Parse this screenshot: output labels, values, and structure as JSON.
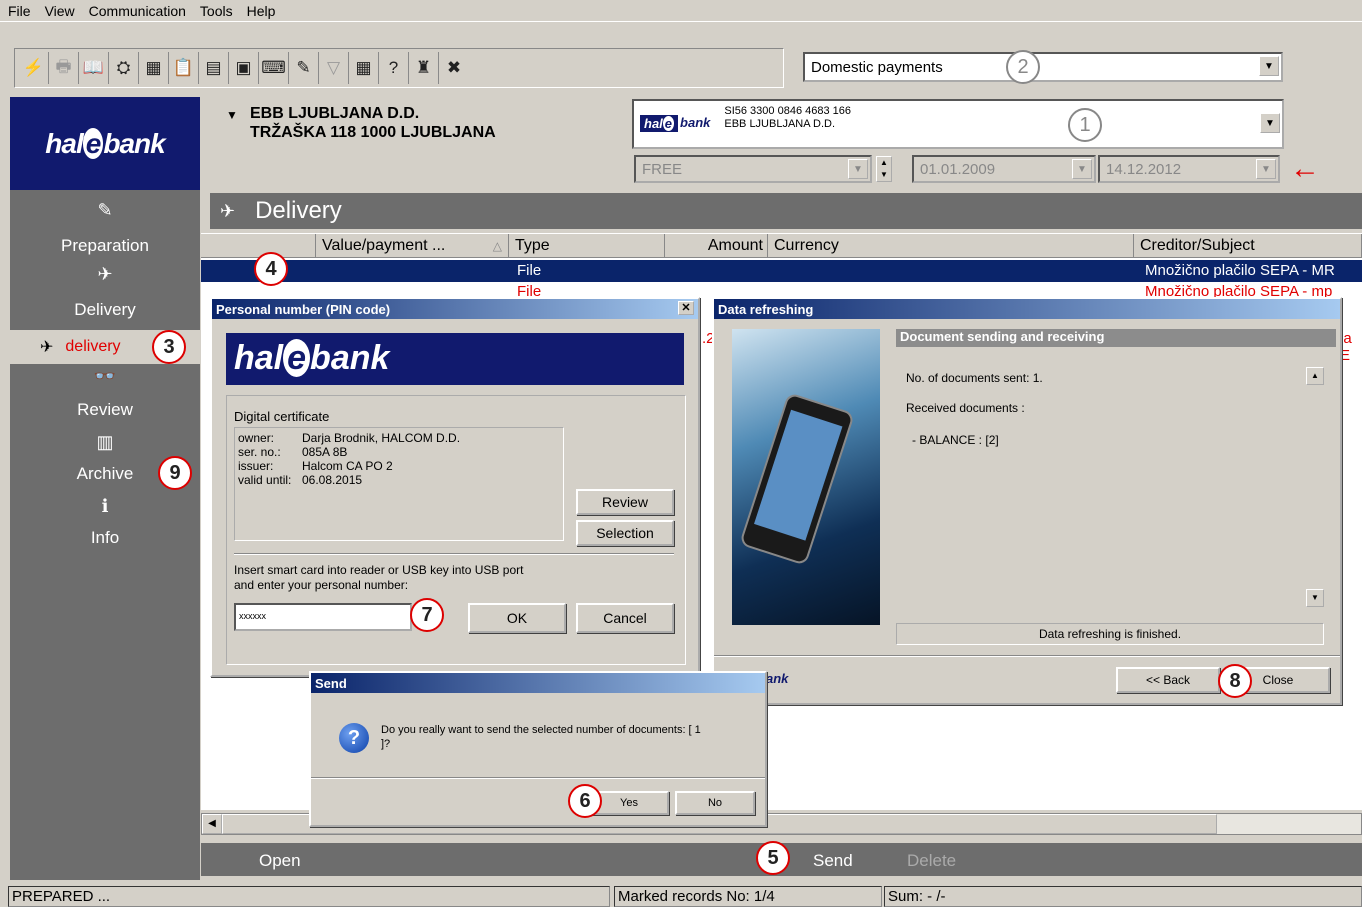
{
  "menu": [
    "File",
    "View",
    "Communication",
    "Tools",
    "Help"
  ],
  "toolbar": {
    "icons": [
      "lightning-icon",
      "printer-icon",
      "book-icon",
      "sync-icon",
      "code-icon",
      "clipboard-icon",
      "form-icon",
      "card-icon",
      "keyboard-icon",
      "edit-icon",
      "filter-icon",
      "calculator-icon",
      "help-icon",
      "lock-icon",
      "close-x-icon"
    ],
    "glyphs": [
      "⚡",
      "🖶",
      "📖",
      "⛭",
      "▦",
      "📋",
      "▤",
      "▣",
      "⌨",
      "✎",
      "▽",
      "▦",
      "?",
      "♜",
      "✖"
    ],
    "payment_type": "Domestic payments"
  },
  "callouts": {
    "c1": "1",
    "c2": "2",
    "c3": "3",
    "c4": "4",
    "c5": "5",
    "c6": "6",
    "c7": "7",
    "c8": "8",
    "c9": "9"
  },
  "logo": {
    "pre": "hal",
    "e": "e",
    "post": "bank"
  },
  "bank": {
    "name": "EBB LJUBLJANA D.D.",
    "address": "TRŽAŠKA 118 1000 LJUBLJANA",
    "account_number": "SI56 3300 0846 4683 166",
    "account_name": "EBB LJUBLJANA D.D.",
    "filter": "FREE",
    "date_from": "01.01.2009",
    "date_to": "14.12.2012"
  },
  "sidebar": {
    "preparation": "Preparation",
    "delivery": "Delivery",
    "delivery_sub": "delivery",
    "review": "Review",
    "archive": "Archive",
    "info": "Info"
  },
  "main": {
    "title": "Delivery",
    "columns": [
      "Value/payment ...",
      "Type",
      "Amount",
      "Currency",
      "Creditor/Subject"
    ],
    "rows": [
      {
        "type": "File",
        "subject": "Množično plačilo SEPA - MR"
      },
      {
        "type": "File",
        "subject": "Množično plačilo SEPA - mp"
      }
    ],
    "row3_frag": ".2",
    "row3_subject": "ja E"
  },
  "pin_dialog": {
    "title": "Personal number (PIN code)",
    "cert_label": "Digital certificate",
    "owner_k": "owner:",
    "owner_v": "Darja Brodnik, HALCOM D.D.",
    "ser_k": "ser. no.:",
    "ser_v": "085A 8B",
    "issuer_k": "issuer:",
    "issuer_v": "Halcom CA PO 2",
    "valid_k": "valid until:",
    "valid_v": "06.08.2015",
    "review": "Review",
    "selection": "Selection",
    "instruction1": "Insert smart card into reader or USB key into USB port",
    "instruction2": "and enter your personal number:",
    "pin_value": "xxxxxx",
    "ok": "OK",
    "cancel": "Cancel"
  },
  "refresh_dialog": {
    "title": "Data refreshing",
    "section": "Document sending and receiving",
    "line1": "No. of documents sent: 1.",
    "line2": "Received documents :",
    "line3": "- BALANCE : [2]",
    "status": "Data refreshing is finished.",
    "back": "<< Back",
    "close": "Close"
  },
  "send_dialog": {
    "title": "Send",
    "message": "Do you really want to send the selected number of documents: [ 1",
    "message2": "]?",
    "yes": "Yes",
    "no": "No"
  },
  "actions": {
    "open": "Open",
    "send": "Send",
    "delete": "Delete"
  },
  "status": {
    "state": "PREPARED ...",
    "marked": "Marked records No: 1/4",
    "sum": "Sum: - /-"
  }
}
